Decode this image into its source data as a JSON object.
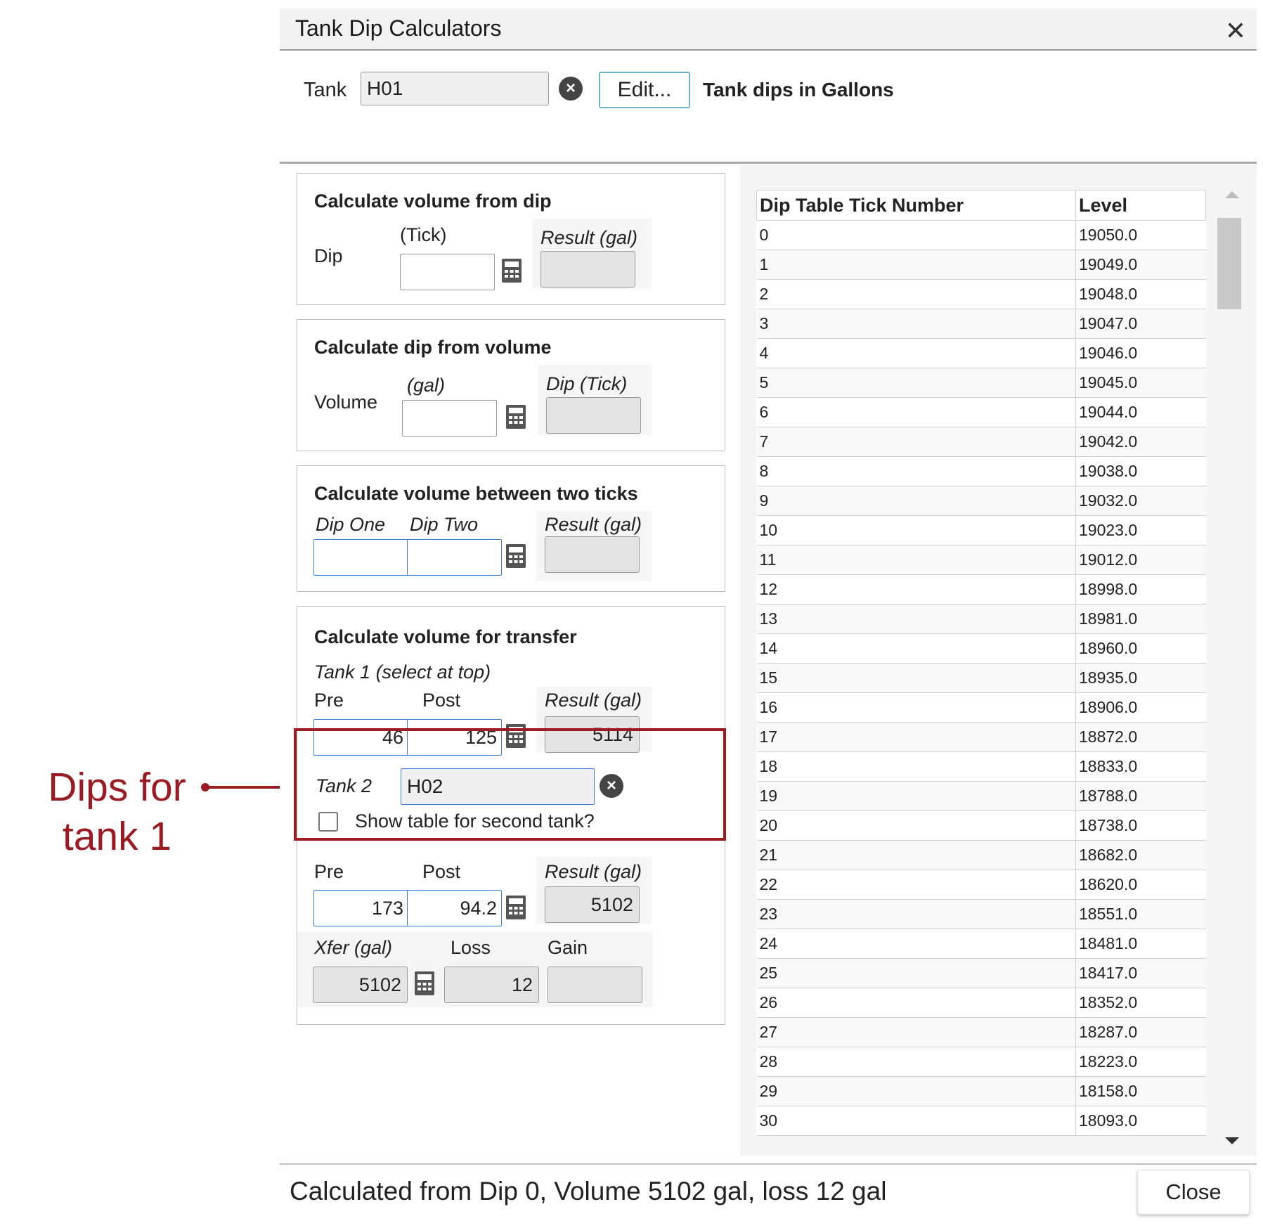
{
  "dialog": {
    "title": "Tank Dip Calculators",
    "close_icon": "close-icon",
    "tank_label": "Tank",
    "tank_value": "H01",
    "edit_label": "Edit...",
    "units_note": "Tank dips in Gallons"
  },
  "panels": {
    "vol_from_dip": {
      "title": "Calculate volume from dip",
      "row_label": "Dip",
      "input_header": "(Tick)",
      "result_header": "Result (gal)",
      "input_value": "",
      "result_value": ""
    },
    "dip_from_vol": {
      "title": "Calculate dip from volume",
      "row_label": "Volume",
      "input_header": "(gal)",
      "result_header": "Dip (Tick)",
      "input_value": "",
      "result_value": ""
    },
    "between_ticks": {
      "title": "Calculate volume between two ticks",
      "dip_one_label": "Dip One",
      "dip_two_label": "Dip Two",
      "result_header": "Result (gal)",
      "dip_one_value": "",
      "dip_two_value": "",
      "result_value": ""
    },
    "transfer": {
      "title": "Calculate volume for transfer",
      "tank1_label": "Tank 1 (select at top)",
      "pre_label": "Pre",
      "post_label": "Post",
      "result_header": "Result (gal)",
      "tank1_pre": "46",
      "tank1_post": "125",
      "tank1_result": "5114",
      "tank2_label": "Tank 2",
      "tank2_value": "H02",
      "show_table_label": "Show table for second tank?",
      "show_table_checked": false,
      "tank2_pre_label": "Pre",
      "tank2_post_label": "Post",
      "tank2_result_header": "Result (gal)",
      "tank2_pre": "173",
      "tank2_post": "94.2",
      "tank2_result": "5102",
      "xfer_label": "Xfer (gal)",
      "loss_label": "Loss",
      "gain_label": "Gain",
      "xfer_value": "5102",
      "loss_value": "12",
      "gain_value": ""
    }
  },
  "dip_table": {
    "headers": [
      "Dip Table Tick Number",
      "Level"
    ],
    "rows": [
      [
        "0",
        "19050.0"
      ],
      [
        "1",
        "19049.0"
      ],
      [
        "2",
        "19048.0"
      ],
      [
        "3",
        "19047.0"
      ],
      [
        "4",
        "19046.0"
      ],
      [
        "5",
        "19045.0"
      ],
      [
        "6",
        "19044.0"
      ],
      [
        "7",
        "19042.0"
      ],
      [
        "8",
        "19038.0"
      ],
      [
        "9",
        "19032.0"
      ],
      [
        "10",
        "19023.0"
      ],
      [
        "11",
        "19012.0"
      ],
      [
        "12",
        "18998.0"
      ],
      [
        "13",
        "18981.0"
      ],
      [
        "14",
        "18960.0"
      ],
      [
        "15",
        "18935.0"
      ],
      [
        "16",
        "18906.0"
      ],
      [
        "17",
        "18872.0"
      ],
      [
        "18",
        "18833.0"
      ],
      [
        "19",
        "18788.0"
      ],
      [
        "20",
        "18738.0"
      ],
      [
        "21",
        "18682.0"
      ],
      [
        "22",
        "18620.0"
      ],
      [
        "23",
        "18551.0"
      ],
      [
        "24",
        "18481.0"
      ],
      [
        "25",
        "18417.0"
      ],
      [
        "26",
        "18352.0"
      ],
      [
        "27",
        "18287.0"
      ],
      [
        "28",
        "18223.0"
      ],
      [
        "29",
        "18158.0"
      ],
      [
        "30",
        "18093.0"
      ]
    ]
  },
  "footer": {
    "status": "Calculated from Dip 0, Volume 5102 gal, loss 12 gal",
    "close_label": "Close"
  },
  "annotation": {
    "text": "Dips for tank 1",
    "color": "#9b1b22"
  },
  "colors": {
    "accent_blue": "#3a7fd5",
    "edit_border": "#6ab4c8"
  }
}
